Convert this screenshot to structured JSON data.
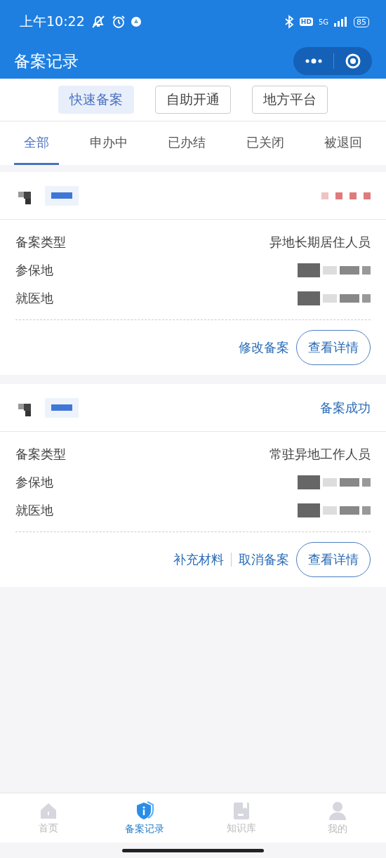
{
  "status_bar": {
    "time": "上午10:22",
    "hd": "HD",
    "network": "5G",
    "battery": "85"
  },
  "header": {
    "title": "备案记录"
  },
  "filters": [
    {
      "label": "快速备案",
      "selected": true
    },
    {
      "label": "自助开通",
      "selected": false
    },
    {
      "label": "地方平台",
      "selected": false
    }
  ],
  "tabs": [
    {
      "label": "全部",
      "selected": true
    },
    {
      "label": "申办中",
      "selected": false
    },
    {
      "label": "已办结",
      "selected": false
    },
    {
      "label": "已关闭",
      "selected": false
    },
    {
      "label": "被退回",
      "selected": false
    }
  ],
  "records": [
    {
      "status_redacted": true,
      "fields": [
        {
          "label": "备案类型",
          "value": "异地长期居住人员"
        },
        {
          "label": "参保地",
          "redacted": true
        },
        {
          "label": "就医地",
          "redacted": true
        }
      ],
      "actions": [
        {
          "label": "修改备案",
          "kind": "link"
        },
        {
          "label": "查看详情",
          "kind": "outline"
        }
      ]
    },
    {
      "status": "备案成功",
      "fields": [
        {
          "label": "备案类型",
          "value": "常驻异地工作人员"
        },
        {
          "label": "参保地",
          "redacted": true
        },
        {
          "label": "就医地",
          "redacted": true
        }
      ],
      "actions": [
        {
          "label": "补充材料",
          "kind": "link"
        },
        {
          "label": "取消备案",
          "kind": "link"
        },
        {
          "label": "查看详情",
          "kind": "outline"
        }
      ]
    }
  ],
  "bottom_nav": [
    {
      "label": "首页",
      "selected": false,
      "kind": "home"
    },
    {
      "label": "备案记录",
      "selected": true,
      "kind": "shield"
    },
    {
      "label": "知识库",
      "selected": false,
      "kind": "book"
    },
    {
      "label": "我的",
      "selected": false,
      "kind": "person"
    }
  ]
}
